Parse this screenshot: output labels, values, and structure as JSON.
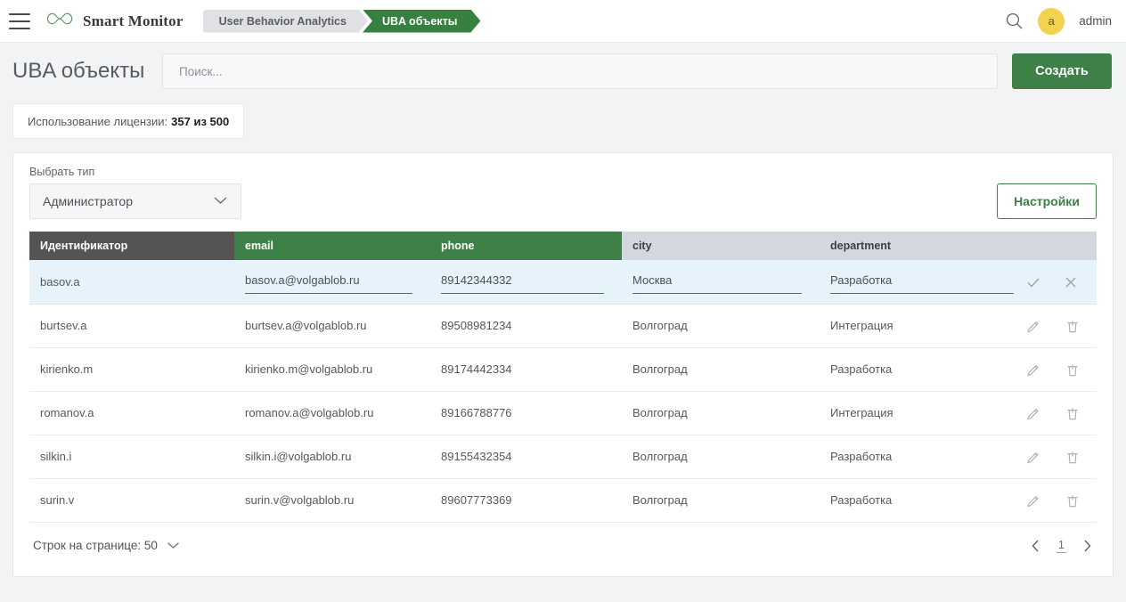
{
  "topbar": {
    "menu_icon": "hamburger-icon",
    "logo_icon": "infinity-logo-icon",
    "brand": "Smart Monitor",
    "breadcrumbs": [
      {
        "label": "User Behavior Analytics",
        "active": false
      },
      {
        "label": "UBA объекты",
        "active": true
      }
    ],
    "search_icon": "search-icon",
    "avatar_letter": "a",
    "user_name": "admin",
    "accent_green": "#3e8047",
    "avatar_color": "#f2d24f"
  },
  "page": {
    "title": "UBA объекты",
    "search_placeholder": "Поиск...",
    "search_value": "",
    "create_label": "Создать",
    "license_label": "Использование лицензии:",
    "license_value": "357 из 500"
  },
  "filter": {
    "type_label": "Выбрать тип",
    "type_value": "Администратор",
    "chevron_icon": "chevron-down-icon",
    "settings_label": "Настройки"
  },
  "table": {
    "columns": [
      "Идентификатор",
      "email",
      "phone",
      "city",
      "department"
    ],
    "editing_row": {
      "id": "basov.a",
      "email": "basov.a@volgablob.ru",
      "phone": "89142344332",
      "city": "Москва",
      "department": "Разработка",
      "confirm_icon": "check-icon",
      "cancel_icon": "close-icon"
    },
    "rows": [
      {
        "id": "burtsev.a",
        "email": "burtsev.a@volgablob.ru",
        "phone": "89508981234",
        "city": "Волгоград",
        "department": "Интеграция"
      },
      {
        "id": "kirienko.m",
        "email": "kirienko.m@volgablob.ru",
        "phone": "89174442334",
        "city": "Волгоград",
        "department": "Разработка"
      },
      {
        "id": "romanov.a",
        "email": "romanov.a@volgablob.ru",
        "phone": "89166788776",
        "city": "Волгоград",
        "department": "Интеграция"
      },
      {
        "id": "silkin.i",
        "email": "silkin.i@volgablob.ru",
        "phone": "89155432354",
        "city": "Волгоград",
        "department": "Разработка"
      },
      {
        "id": "surin.v",
        "email": "surin.v@volgablob.ru",
        "phone": "89607773369",
        "city": "Волгоград",
        "department": "Разработка"
      }
    ],
    "edit_icon": "pencil-icon",
    "delete_icon": "trash-icon"
  },
  "footer": {
    "rows_per_page_label": "Строк на странице: 50",
    "rows_chevron_icon": "chevron-down-icon",
    "prev_icon": "chevron-left-icon",
    "next_icon": "chevron-right-icon",
    "current_page": "1"
  }
}
